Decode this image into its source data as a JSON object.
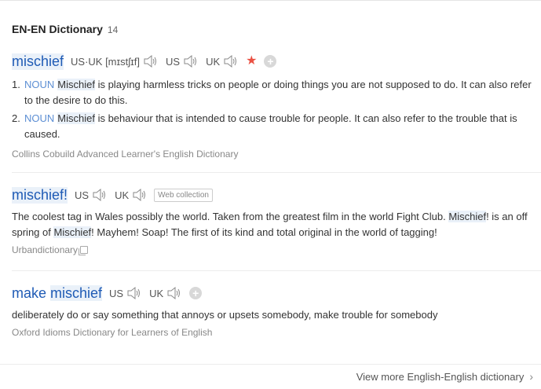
{
  "header": {
    "title": "EN-EN Dictionary",
    "count": "14"
  },
  "entries": [
    {
      "headword": "mischief",
      "pron_usuk": "US·UK [mɪstʃɪf]",
      "us_label": "US",
      "uk_label": "UK",
      "senses": [
        {
          "num": "1.",
          "pos": "NOUN",
          "hl": "Mischief",
          "rest": " is playing harmless tricks on people or doing things you are not supposed to do. It can also refer to the desire to do this."
        },
        {
          "num": "2.",
          "pos": "NOUN",
          "hl": "Mischief",
          "rest": " is behaviour that is intended to cause trouble for people. It can also refer to the trouble that is caused."
        }
      ],
      "source": "Collins Cobuild Advanced Learner's English Dictionary"
    },
    {
      "headword": "mischief!",
      "us_label": "US",
      "uk_label": "UK",
      "tag": "Web collection",
      "t1": "The coolest tag in Wales possibly the world. Taken from the greatest film in the world Fight Club. ",
      "h1": "Mischief",
      "t2": "! is an off spring of ",
      "h2": "Mischief",
      "t3": "! Mayhem! Soap! The first of its kind and total original in the world of tagging!",
      "source": "Urbandictionary"
    },
    {
      "headword_prefix": "make ",
      "headword_hl": "mischief",
      "us_label": "US",
      "uk_label": "UK",
      "definition": "deliberately do or say something that annoys or upsets somebody, make trouble for somebody",
      "source": "Oxford Idioms Dictionary for Learners of English"
    }
  ],
  "footer": {
    "more_link": "View more English-English dictionary"
  },
  "colors": {
    "headword": "#1f5bb5",
    "highlight": "#eaf1f9",
    "star": "#ea5143",
    "pos": "#5d8fd4"
  },
  "icons": {
    "speaker": "speaker-icon",
    "star": "star-icon",
    "add": "plus-circle-icon",
    "copy": "copy-icon",
    "chevron": "chevron-right-icon"
  }
}
